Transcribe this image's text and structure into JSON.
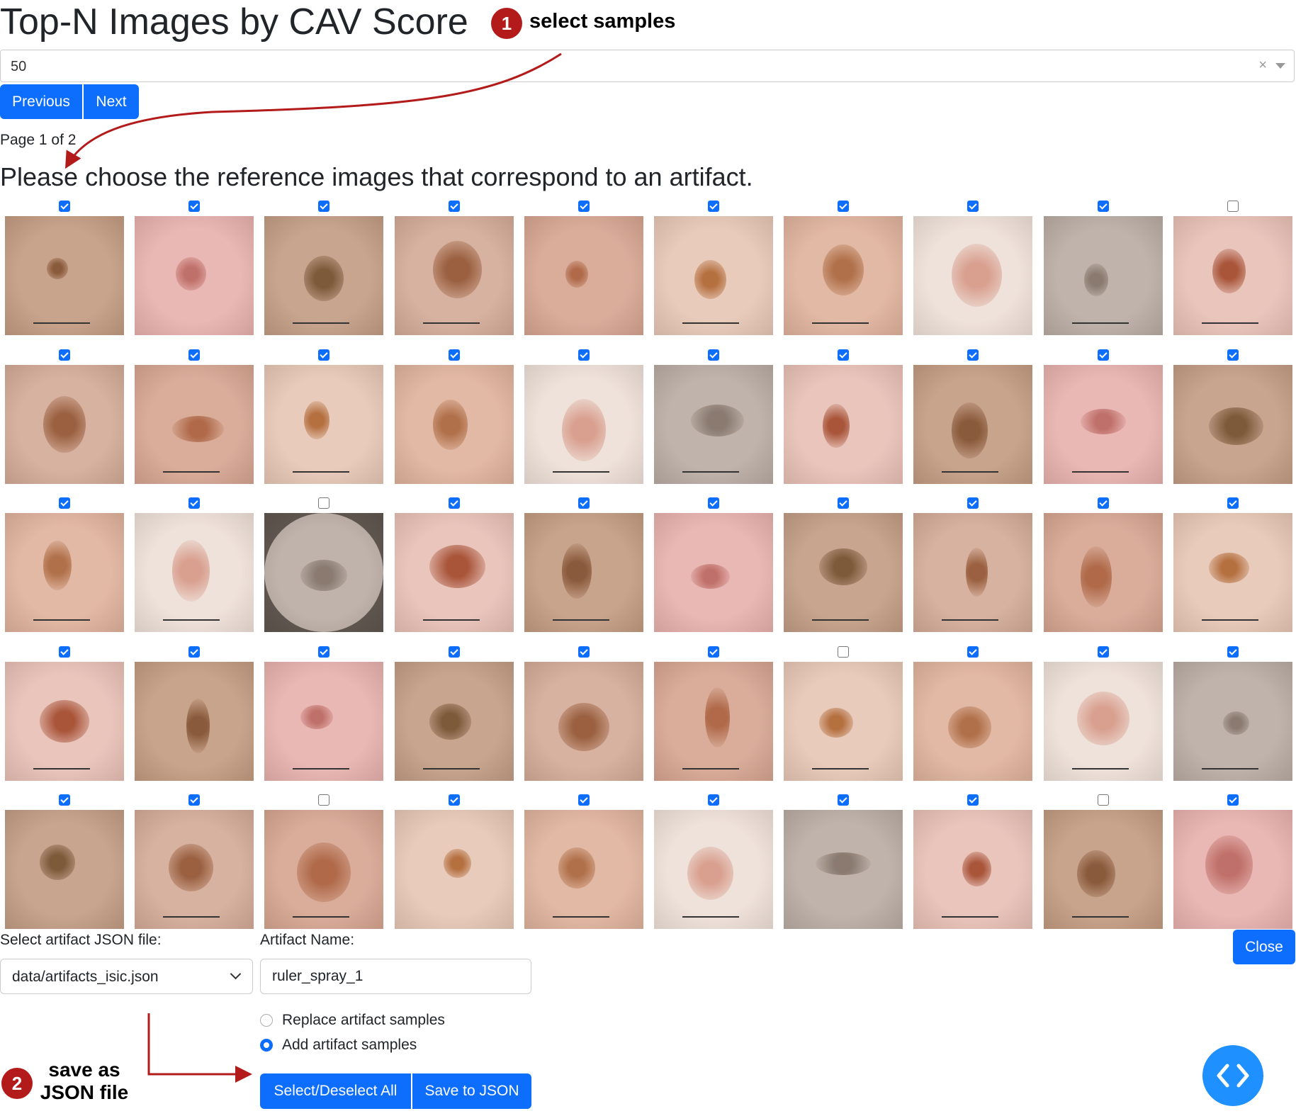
{
  "header": {
    "title": "Top-N Images by CAV Score",
    "step1_badge": "1",
    "step1_text": "select samples"
  },
  "topn": {
    "value": "50",
    "clear": "×"
  },
  "pagination": {
    "previous": "Previous",
    "next": "Next",
    "page_info": "Page 1 of 2"
  },
  "instruction": "Please choose the reference images that correspond to an artifact.",
  "grid": {
    "rows": 5,
    "cols": 10,
    "checked": [
      [
        true,
        true,
        true,
        true,
        true,
        true,
        true,
        true,
        true,
        false
      ],
      [
        true,
        true,
        true,
        true,
        true,
        true,
        true,
        true,
        true,
        true
      ],
      [
        true,
        true,
        false,
        true,
        true,
        true,
        true,
        true,
        true,
        true
      ],
      [
        true,
        true,
        true,
        true,
        true,
        true,
        false,
        true,
        true,
        true
      ],
      [
        true,
        true,
        false,
        true,
        true,
        true,
        true,
        true,
        false,
        true
      ]
    ]
  },
  "form": {
    "json_label": "Select artifact JSON file:",
    "json_value": "data/artifacts_isic.json",
    "artifact_label": "Artifact Name:",
    "artifact_value": "ruler_spray_1",
    "radio_replace": "Replace artifact samples",
    "radio_add": "Add artifact samples",
    "radio_selected": "add",
    "select_all": "Select/Deselect All",
    "save": "Save to JSON",
    "close": "Close"
  },
  "step2": {
    "badge": "2",
    "line1": "save as",
    "line2": "JSON file"
  },
  "colors": {
    "primary": "#0d6efd",
    "annotation": "#b31b1b",
    "fab": "#1e90ff"
  },
  "icons": {
    "code_fab": "code-brackets-icon",
    "select_caret": "chevron-down-icon",
    "clear": "clear-icon"
  }
}
